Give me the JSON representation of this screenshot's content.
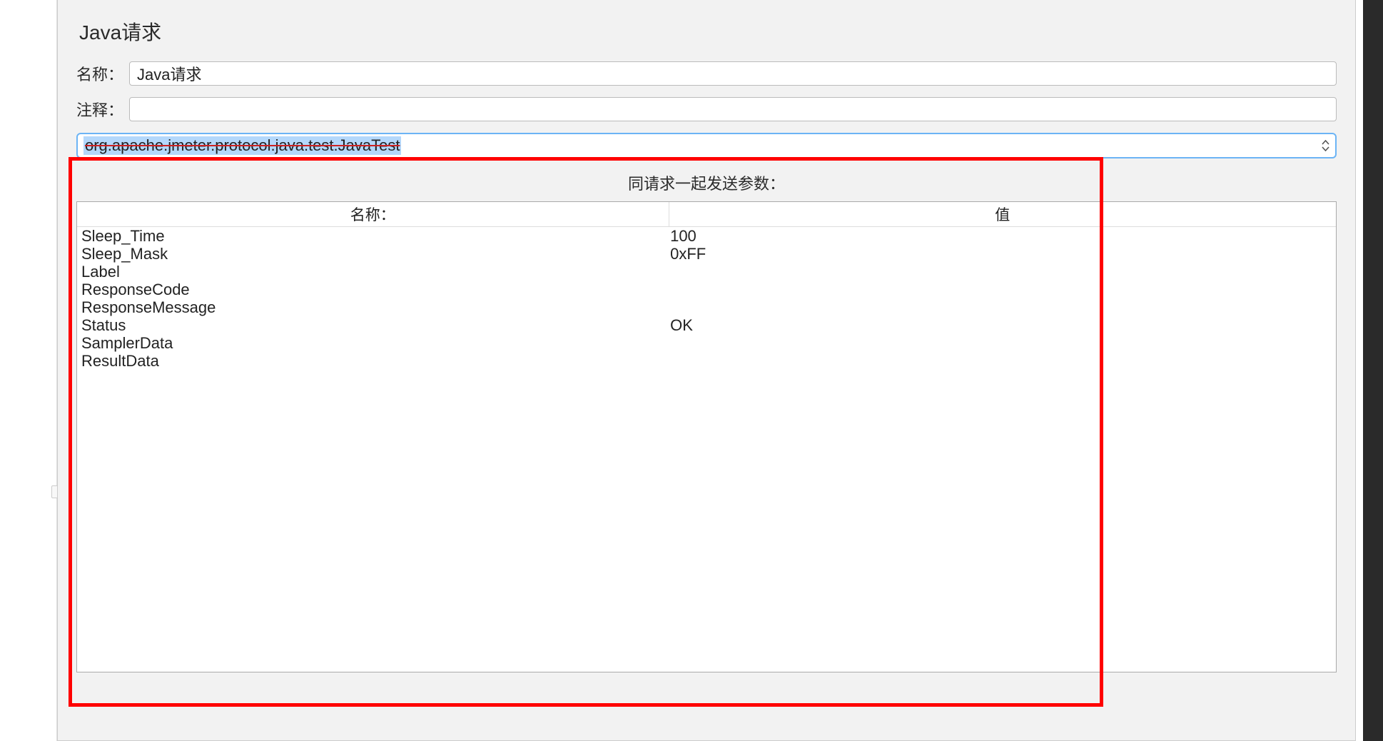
{
  "title": "Java请求",
  "labels": {
    "name": "名称：",
    "comment": "注释："
  },
  "fields": {
    "name": "Java请求",
    "comment": ""
  },
  "classname": "org.apache.jmeter.protocol.java.test.JavaTest",
  "sectionLabel": "同请求一起发送参数：",
  "columns": {
    "name": "名称：",
    "value": "值"
  },
  "params": [
    {
      "name": "Sleep_Time",
      "value": "100"
    },
    {
      "name": "Sleep_Mask",
      "value": "0xFF"
    },
    {
      "name": "Label",
      "value": ""
    },
    {
      "name": "ResponseCode",
      "value": ""
    },
    {
      "name": "ResponseMessage",
      "value": ""
    },
    {
      "name": "Status",
      "value": "OK"
    },
    {
      "name": "SamplerData",
      "value": ""
    },
    {
      "name": "ResultData",
      "value": ""
    }
  ]
}
